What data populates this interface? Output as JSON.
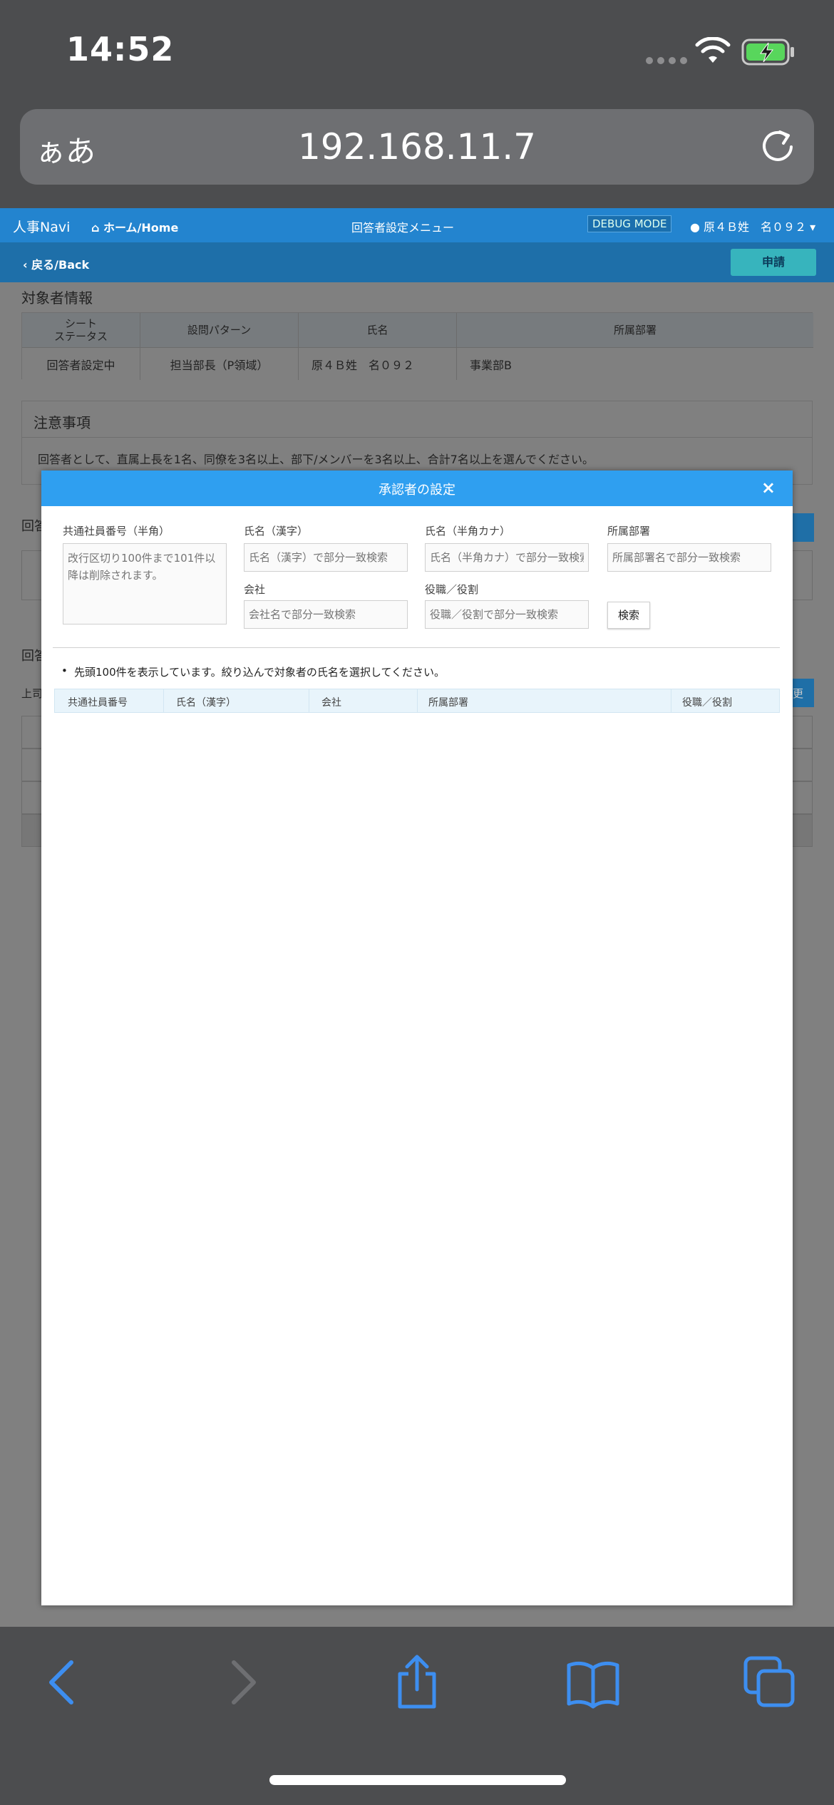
{
  "status_bar": {
    "time": "14:52"
  },
  "url_bar": {
    "aa_label": "ぁあ",
    "url": "192.168.11.7"
  },
  "navbar": {
    "brand": "人事Navi",
    "home": "ホーム/Home",
    "menu_title": "回答者設定メニュー",
    "debug_badge": "DEBUG MODE",
    "user": "原４Ｂ姓　名０９２"
  },
  "subbar": {
    "back": "戻る/Back",
    "apply": "申請"
  },
  "target_info": {
    "heading": "対象者情報",
    "columns": [
      "シート\nステータス",
      "設問パターン",
      "氏名",
      "所属部署"
    ],
    "row": [
      "回答者設定中",
      "担当部長（P領域）",
      "原４Ｂ姓　名０９２",
      "事業部B"
    ]
  },
  "notice": {
    "heading": "注意事項",
    "body": "回答者として、直属上長を1名、同僚を3名以上、部下/メンバーを3名以上、合計7名以上を選んでください。"
  },
  "background_fragments": {
    "a": "回答",
    "b": "回答",
    "c": "上司",
    "d": "更"
  },
  "modal": {
    "title": "承認者の設定",
    "close": "×",
    "employee_no_label": "共通社員番号（半角）",
    "employee_no_placeholder": "改行区切り100件まで101件以降は削除されます。",
    "name_kanji_label": "氏名（漢字）",
    "name_kanji_placeholder": "氏名（漢字）で部分一致検索",
    "name_kana_label": "氏名（半角カナ）",
    "name_kana_placeholder": "氏名（半角カナ）で部分一致検索",
    "dept_label": "所属部署",
    "dept_placeholder": "所属部署名で部分一致検索",
    "company_label": "会社",
    "company_placeholder": "会社名で部分一致検索",
    "role_label": "役職／役割",
    "role_placeholder": "役職／役割で部分一致検索",
    "search_button": "検索",
    "note": "先頭100件を表示しています。絞り込んで対象者の氏名を選択してください。",
    "result_columns": [
      "共通社員番号",
      "氏名（漢字）",
      "会社",
      "所属部署",
      "役職／役割"
    ]
  },
  "colors": {
    "accent": "#2f9ff0",
    "navbar": "#2384cf",
    "apply": "#37b4bd",
    "ios_blue": "#3d8ef0"
  }
}
